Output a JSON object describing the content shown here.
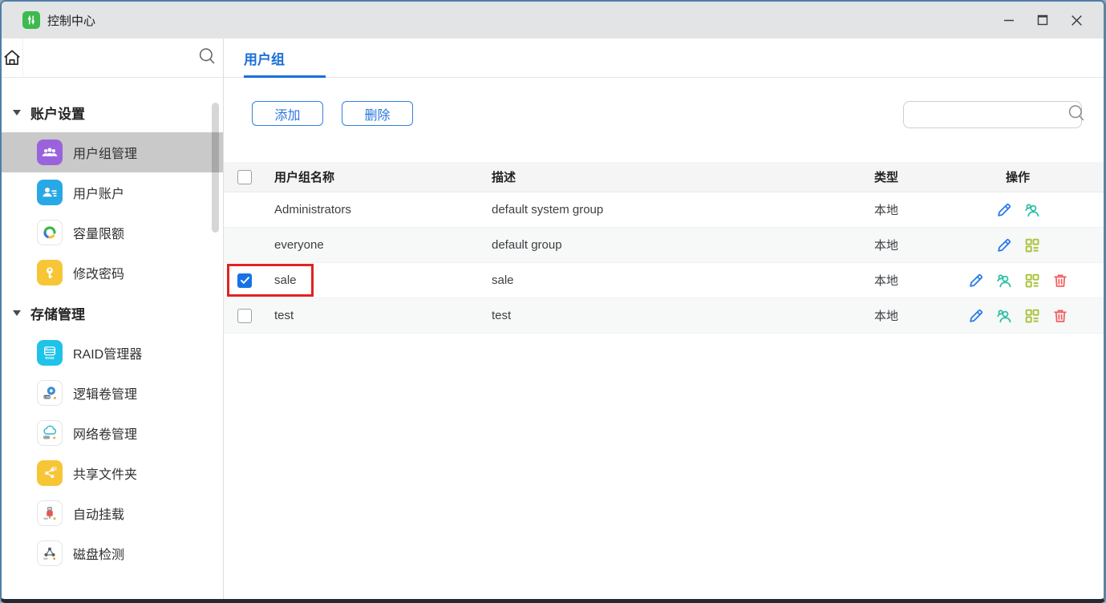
{
  "window": {
    "title": "控制中心",
    "controls": {
      "minimize": "最小化",
      "maximize": "最大化",
      "close": "关闭"
    }
  },
  "sidebar": {
    "sections": [
      {
        "label": "账户设置",
        "items": [
          {
            "label": "用户组管理",
            "icon": "user-group",
            "selected": true
          },
          {
            "label": "用户账户",
            "icon": "user-account",
            "selected": false
          },
          {
            "label": "容量限额",
            "icon": "quota",
            "selected": false
          },
          {
            "label": "修改密码",
            "icon": "password",
            "selected": false
          }
        ]
      },
      {
        "label": "存储管理",
        "items": [
          {
            "label": "RAID管理器",
            "icon": "raid",
            "selected": false
          },
          {
            "label": "逻辑卷管理",
            "icon": "lvm",
            "selected": false
          },
          {
            "label": "网络卷管理",
            "icon": "network-volume",
            "selected": false
          },
          {
            "label": "共享文件夹",
            "icon": "shared-folder",
            "selected": false
          },
          {
            "label": "自动挂载",
            "icon": "auto-mount",
            "selected": false
          },
          {
            "label": "磁盘检测",
            "icon": "disk-check",
            "selected": false
          }
        ]
      }
    ]
  },
  "tabs": [
    {
      "label": "用户组",
      "active": true
    }
  ],
  "toolbar": {
    "add": "添加",
    "delete": "删除",
    "search_value": "",
    "search_placeholder": ""
  },
  "table": {
    "columns": {
      "name": "用户组名称",
      "description": "描述",
      "type": "类型",
      "actions": "操作"
    },
    "rows": [
      {
        "name": "Administrators",
        "description": "default system group",
        "type": "本地",
        "has_checkbox": false,
        "checked": false,
        "highlighted": false,
        "actions": [
          "edit",
          "members"
        ]
      },
      {
        "name": "everyone",
        "description": "default group",
        "type": "本地",
        "has_checkbox": false,
        "checked": false,
        "highlighted": false,
        "actions": [
          "edit",
          "permissions"
        ]
      },
      {
        "name": "sale",
        "description": "sale",
        "type": "本地",
        "has_checkbox": true,
        "checked": true,
        "highlighted": true,
        "actions": [
          "edit",
          "members",
          "permissions",
          "delete"
        ]
      },
      {
        "name": "test",
        "description": "test",
        "type": "本地",
        "has_checkbox": true,
        "checked": false,
        "highlighted": false,
        "actions": [
          "edit",
          "members",
          "permissions",
          "delete"
        ]
      }
    ]
  },
  "colors": {
    "accent_blue": "#1a6fd8",
    "checkbox_checked": "#1673e6",
    "highlight_box_red": "#e02222",
    "action_edit": "#2b7de8",
    "action_members": "#2cbfa4",
    "action_permissions": "#a9c23c",
    "action_delete": "#f15e5e",
    "icon_user_group": "#9a63dd",
    "icon_user_account": "#29a8e6",
    "icon_password": "#f7c636",
    "icon_raid": "#1fc3e8",
    "icon_shared_folder": "#f7c636"
  }
}
